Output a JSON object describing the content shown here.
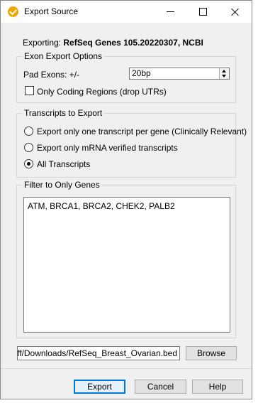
{
  "window": {
    "title": "Export Source"
  },
  "exporting": {
    "label": "Exporting:",
    "value": "RefSeq Genes 105.20220307, NCBI"
  },
  "exon_group": {
    "title": "Exon Export Options",
    "pad_label": "Pad Exons: +/-",
    "pad_value": "20bp",
    "coding_label": "Only Coding Regions (drop UTRs)",
    "coding_checked": false
  },
  "transcripts_group": {
    "title": "Transcripts to Export",
    "options": [
      {
        "label": "Export only one transcript per gene (Clinically Relevant)",
        "selected": false
      },
      {
        "label": "Export only mRNA verified transcripts",
        "selected": false
      },
      {
        "label": "All Transcripts",
        "selected": true
      }
    ]
  },
  "genes_group": {
    "title": "Filter to Only Genes",
    "genes": "ATM, BRCA1, BRCA2, CHEK2, PALB2"
  },
  "output": {
    "path": "ankoff/Downloads/RefSeq_Breast_Ovarian.bed",
    "browse_label": "Browse"
  },
  "buttons": {
    "export": "Export",
    "cancel": "Cancel",
    "help": "Help"
  },
  "colors": {
    "accent": "#0078d7",
    "app_icon": "#f0a800"
  }
}
